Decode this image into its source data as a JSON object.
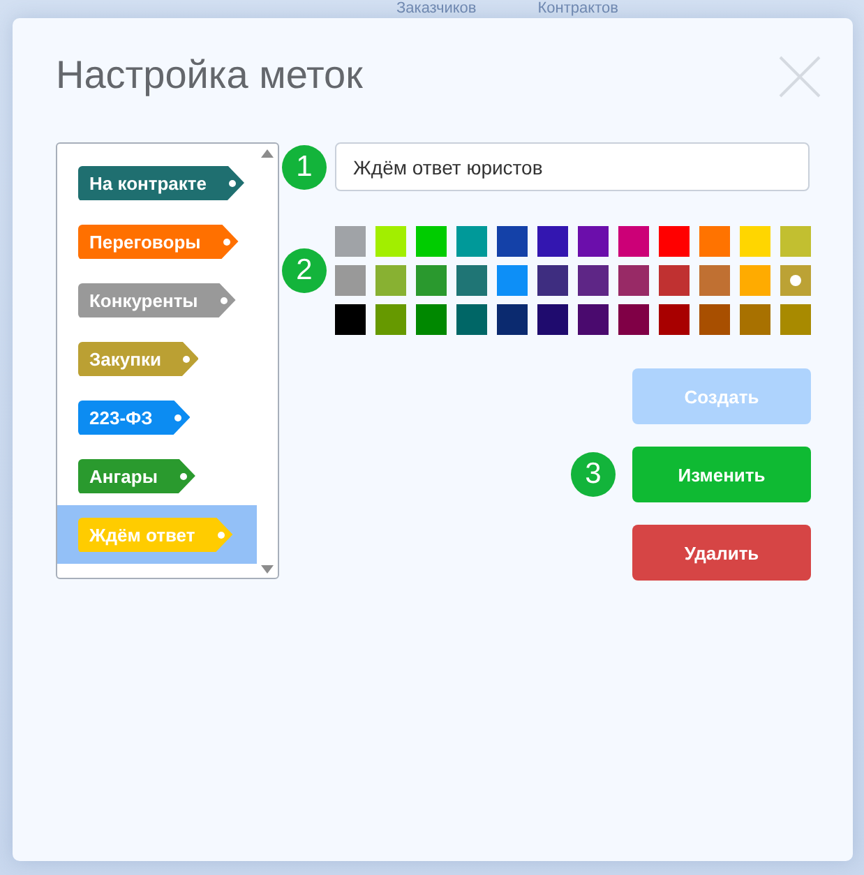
{
  "background": {
    "nav": [
      "Заказчиков",
      "Контрактов"
    ]
  },
  "dialog": {
    "title": "Настройка меток",
    "tags": [
      {
        "label": "На контракте",
        "color": "#1f6f70",
        "selected": false
      },
      {
        "label": "Переговоры",
        "color": "#ff7000",
        "selected": false
      },
      {
        "label": "Конкуренты",
        "color": "#999999",
        "selected": false
      },
      {
        "label": "Закупки",
        "color": "#bba033",
        "selected": false
      },
      {
        "label": "223-ФЗ",
        "color": "#0c8cf2",
        "selected": false
      },
      {
        "label": "Ангары",
        "color": "#2a9a2e",
        "selected": false
      },
      {
        "label": "Ждём ответ",
        "color": "#ffcc00",
        "selected": true
      }
    ],
    "name_field": {
      "step": "1",
      "value": "Ждём ответ юристов"
    },
    "palette": {
      "step": "2",
      "swatches": [
        {
          "color": "#a0a3a7",
          "selected": false
        },
        {
          "color": "#a2ee00",
          "selected": false
        },
        {
          "color": "#00cc00",
          "selected": false
        },
        {
          "color": "#009999",
          "selected": false
        },
        {
          "color": "#1441a8",
          "selected": false
        },
        {
          "color": "#3316b0",
          "selected": false
        },
        {
          "color": "#6b0eab",
          "selected": false
        },
        {
          "color": "#cc0077",
          "selected": false
        },
        {
          "color": "#ff0000",
          "selected": false
        },
        {
          "color": "#ff7300",
          "selected": false
        },
        {
          "color": "#ffd600",
          "selected": false
        },
        {
          "color": "#c2bf30",
          "selected": false
        },
        {
          "color": "#999999",
          "selected": false
        },
        {
          "color": "#88b132",
          "selected": false
        },
        {
          "color": "#2a992e",
          "selected": false
        },
        {
          "color": "#1f7575",
          "selected": false
        },
        {
          "color": "#0d8ff7",
          "selected": false
        },
        {
          "color": "#3e2d80",
          "selected": false
        },
        {
          "color": "#5e2686",
          "selected": false
        },
        {
          "color": "#982a66",
          "selected": false
        },
        {
          "color": "#c03131",
          "selected": false
        },
        {
          "color": "#c07032",
          "selected": false
        },
        {
          "color": "#ffab00",
          "selected": false
        },
        {
          "color": "#bca235",
          "selected": true
        },
        {
          "color": "#000000",
          "selected": false
        },
        {
          "color": "#669900",
          "selected": false
        },
        {
          "color": "#008800",
          "selected": false
        },
        {
          "color": "#006666",
          "selected": false
        },
        {
          "color": "#0b2a6f",
          "selected": false
        },
        {
          "color": "#1f0b6e",
          "selected": false
        },
        {
          "color": "#4a0a6e",
          "selected": false
        },
        {
          "color": "#800046",
          "selected": false
        },
        {
          "color": "#a80000",
          "selected": false
        },
        {
          "color": "#a84f00",
          "selected": false
        },
        {
          "color": "#a87100",
          "selected": false
        },
        {
          "color": "#a88a00",
          "selected": false
        }
      ]
    },
    "buttons": [
      {
        "label": "Создать",
        "kind": "create",
        "disabled": true
      },
      {
        "label": "Изменить",
        "kind": "edit",
        "disabled": false,
        "step": "3"
      },
      {
        "label": "Удалить",
        "kind": "delete",
        "disabled": false
      }
    ]
  }
}
